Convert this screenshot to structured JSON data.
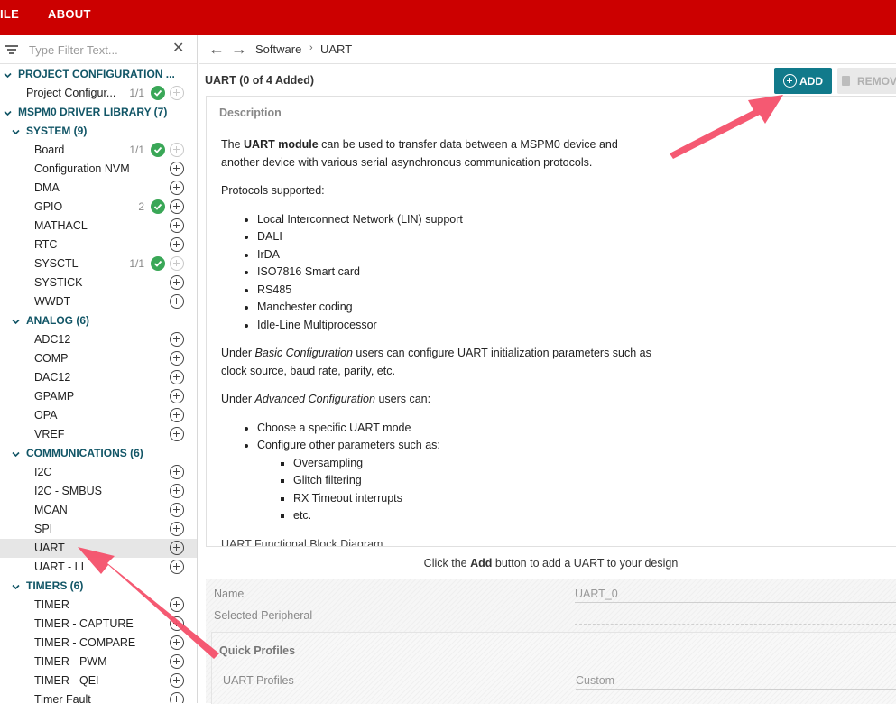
{
  "menu": {
    "items": [
      "ILE",
      "ABOUT"
    ]
  },
  "sidebar": {
    "filter_placeholder": "Type Filter Text...",
    "clear_glyph": "✕",
    "rows": [
      {
        "kind": "category",
        "level": 0,
        "label": "PROJECT CONFIGURATION ..."
      },
      {
        "kind": "item",
        "level": 1,
        "label": "Project Configur...",
        "count": "1/1",
        "status": "check",
        "plus": "disabled"
      },
      {
        "kind": "category",
        "level": 0,
        "label": "MSPM0 DRIVER LIBRARY (7)"
      },
      {
        "kind": "category",
        "level": 1,
        "label": "SYSTEM (9)"
      },
      {
        "kind": "item",
        "level": 2,
        "label": "Board",
        "count": "1/1",
        "status": "check",
        "plus": "disabled"
      },
      {
        "kind": "item",
        "level": 2,
        "label": "Configuration NVM",
        "plus": "enabled"
      },
      {
        "kind": "item",
        "level": 2,
        "label": "DMA",
        "plus": "enabled"
      },
      {
        "kind": "item",
        "level": 2,
        "label": "GPIO",
        "count": "2",
        "status": "check",
        "plus": "enabled"
      },
      {
        "kind": "item",
        "level": 2,
        "label": "MATHACL",
        "plus": "enabled"
      },
      {
        "kind": "item",
        "level": 2,
        "label": "RTC",
        "plus": "enabled"
      },
      {
        "kind": "item",
        "level": 2,
        "label": "SYSCTL",
        "count": "1/1",
        "status": "check",
        "plus": "disabled"
      },
      {
        "kind": "item",
        "level": 2,
        "label": "SYSTICK",
        "plus": "enabled"
      },
      {
        "kind": "item",
        "level": 2,
        "label": "WWDT",
        "plus": "enabled"
      },
      {
        "kind": "category",
        "level": 1,
        "label": "ANALOG (6)"
      },
      {
        "kind": "item",
        "level": 2,
        "label": "ADC12",
        "plus": "enabled"
      },
      {
        "kind": "item",
        "level": 2,
        "label": "COMP",
        "plus": "enabled"
      },
      {
        "kind": "item",
        "level": 2,
        "label": "DAC12",
        "plus": "enabled"
      },
      {
        "kind": "item",
        "level": 2,
        "label": "GPAMP",
        "plus": "enabled"
      },
      {
        "kind": "item",
        "level": 2,
        "label": "OPA",
        "plus": "enabled"
      },
      {
        "kind": "item",
        "level": 2,
        "label": "VREF",
        "plus": "enabled"
      },
      {
        "kind": "category",
        "level": 1,
        "label": "COMMUNICATIONS (6)"
      },
      {
        "kind": "item",
        "level": 2,
        "label": "I2C",
        "plus": "enabled"
      },
      {
        "kind": "item",
        "level": 2,
        "label": "I2C - SMBUS",
        "plus": "enabled"
      },
      {
        "kind": "item",
        "level": 2,
        "label": "MCAN",
        "plus": "enabled"
      },
      {
        "kind": "item",
        "level": 2,
        "label": "SPI",
        "plus": "enabled"
      },
      {
        "kind": "item",
        "level": 2,
        "label": "UART",
        "plus": "enabled",
        "selected": true
      },
      {
        "kind": "item",
        "level": 2,
        "label": "UART - LI",
        "plus": "enabled"
      },
      {
        "kind": "category",
        "level": 1,
        "label": "TIMERS (6)"
      },
      {
        "kind": "item",
        "level": 2,
        "label": "TIMER",
        "plus": "enabled"
      },
      {
        "kind": "item",
        "level": 2,
        "label": "TIMER - CAPTURE",
        "plus": "enabled"
      },
      {
        "kind": "item",
        "level": 2,
        "label": "TIMER - COMPARE",
        "plus": "enabled"
      },
      {
        "kind": "item",
        "level": 2,
        "label": "TIMER - PWM",
        "plus": "enabled"
      },
      {
        "kind": "item",
        "level": 2,
        "label": "TIMER - QEI",
        "plus": "enabled"
      },
      {
        "kind": "item",
        "level": 2,
        "label": "Timer Fault",
        "plus": "enabled"
      }
    ]
  },
  "nav": {
    "back_glyph": "←",
    "forward_glyph": "→",
    "breadcrumb": [
      "Software",
      "UART"
    ],
    "sep": "›"
  },
  "header": {
    "title": "UART (0 of 4 Added)",
    "add_label": "ADD",
    "remove_label": "REMOVE"
  },
  "description": {
    "heading": "Description",
    "p1_bold": "UART module",
    "p1_pre": "The ",
    "p1_post": " can be used to transfer data between a MSPM0 device and another device with various serial asynchronous communication protocols.",
    "p2": "Protocols supported:",
    "protocols": [
      "Local Interconnect Network (LIN) support",
      "DALI",
      "IrDA",
      "ISO7816 Smart card",
      "RS485",
      "Manchester coding",
      "Idle-Line Multiprocessor"
    ],
    "p3_pre": "Under ",
    "p3_em": "Basic Configuration",
    "p3_post": " users can configure UART initialization parameters such as clock source, baud rate, parity, etc.",
    "p4_pre": "Under ",
    "p4_em": "Advanced Configuration",
    "p4_post": " users can:",
    "adv_items": [
      "Choose a specific UART mode",
      "Configure other parameters such as:"
    ],
    "sub_items": [
      "Oversampling",
      "Glitch filtering",
      "RX Timeout interrupts",
      "etc."
    ],
    "cut_line": "UART Functional Block Diagram"
  },
  "hint": {
    "pre": "Click the ",
    "bold": "Add",
    "post": " button to add a UART to your design"
  },
  "config": {
    "name_label": "Name",
    "name_value": "UART_0",
    "peripheral_label": "Selected Peripheral",
    "quick_profiles_title": "Quick Profiles",
    "uart_profiles_label": "UART Profiles",
    "uart_profiles_value": "Custom"
  },
  "colors": {
    "menubar": "#cc0000",
    "accent": "#117a8b",
    "category_text": "#115566",
    "check": "#3aa757",
    "annotation_arrow": "#f4506a"
  }
}
